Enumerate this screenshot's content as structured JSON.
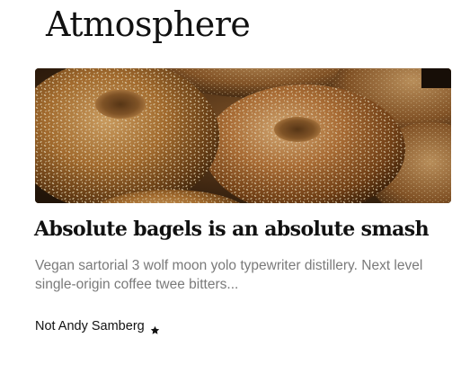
{
  "section": {
    "title": "Atmosphere"
  },
  "article": {
    "image_alt": "sesame-bagels-photo",
    "headline": "Absolute bagels is an absolute smash",
    "excerpt": "Vegan sartorial 3 wolf moon yolo typewriter distillery. Next level single-origin coffee twee bitters...",
    "author": "Not Andy Samberg",
    "author_badge_icon": "star-icon"
  },
  "colors": {
    "headline": "#111111",
    "excerpt": "#7a7a7a",
    "background": "#ffffff"
  }
}
